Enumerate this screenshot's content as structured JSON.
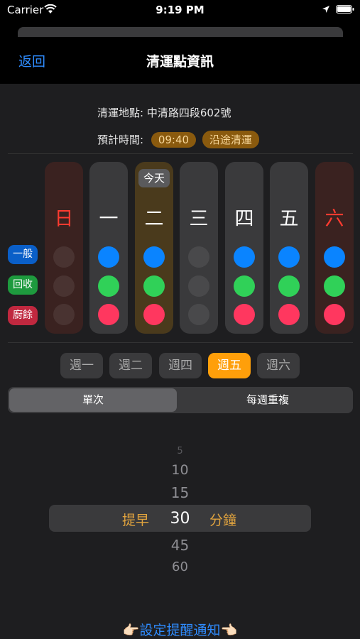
{
  "status": {
    "carrier": "Carrier",
    "time": "9:19 PM"
  },
  "nav": {
    "back": "返回",
    "title": "清運點資訊"
  },
  "info": {
    "address_label": "清運地點:",
    "address": "中清路四段602號",
    "time_label": "預計時間:",
    "time": "09:40",
    "tag": "沿途清運"
  },
  "week": [
    {
      "label": "日",
      "weekend": true,
      "dots": [
        false,
        false,
        false
      ]
    },
    {
      "label": "一",
      "weekend": false,
      "dots": [
        true,
        true,
        true
      ]
    },
    {
      "label": "二",
      "weekend": false,
      "today": true,
      "dots": [
        true,
        true,
        true
      ]
    },
    {
      "label": "三",
      "weekend": false,
      "dots": [
        false,
        false,
        false
      ]
    },
    {
      "label": "四",
      "weekend": false,
      "dots": [
        true,
        true,
        true
      ]
    },
    {
      "label": "五",
      "weekend": false,
      "dots": [
        true,
        true,
        true
      ]
    },
    {
      "label": "六",
      "weekend": true,
      "dots": [
        true,
        true,
        true
      ]
    }
  ],
  "today_label": "今天",
  "categories": [
    {
      "label": "一般",
      "color": "#0a5fc8"
    },
    {
      "label": "回收",
      "color": "#1e9a3e"
    },
    {
      "label": "廚餘",
      "color": "#c0283f"
    }
  ],
  "day_chips": [
    {
      "label": "週一",
      "active": false
    },
    {
      "label": "週二",
      "active": false
    },
    {
      "label": "週四",
      "active": false
    },
    {
      "label": "週五",
      "active": true
    },
    {
      "label": "週六",
      "active": false
    }
  ],
  "segments": {
    "single": "單次",
    "repeat": "每週重複",
    "selected": "single"
  },
  "picker": {
    "values": [
      "5",
      "10",
      "15",
      "30",
      "45",
      "60"
    ],
    "selected": "30",
    "prefix": "提早",
    "suffix": "分鐘"
  },
  "notify_button": "👉🏻設定提醒通知👈🏻",
  "colors": {
    "accent": "#2f8cff",
    "orange": "#ff9f0a"
  }
}
